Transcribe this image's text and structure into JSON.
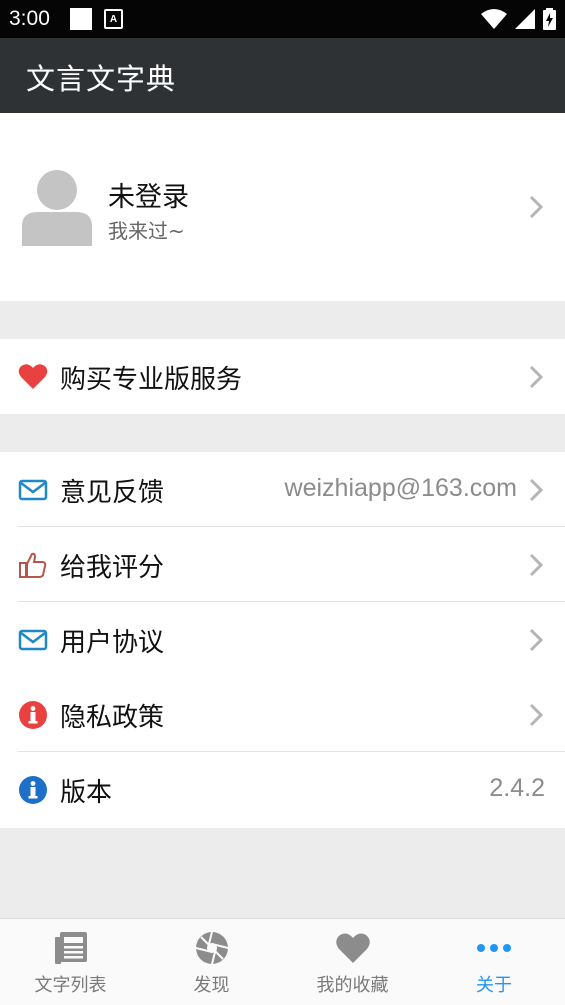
{
  "status_bar": {
    "time": "3:00",
    "a_badge": "A"
  },
  "app_bar": {
    "title": "文言文字典"
  },
  "profile": {
    "name": "未登录",
    "subtitle": "我来过~"
  },
  "menu": {
    "buy_pro": {
      "label": "购买专业版服务",
      "icon": "heart-icon",
      "color": "#e94040"
    },
    "feedback": {
      "label": "意见反馈",
      "value": "weizhiapp@163.com",
      "icon": "mail-icon",
      "color": "#1e88c8"
    },
    "rate": {
      "label": "给我评分",
      "icon": "thumbs-up-icon",
      "color": "#b05a4a"
    },
    "agreement": {
      "label": "用户协议",
      "icon": "mail-icon",
      "color": "#1e88c8"
    },
    "privacy": {
      "label": "隐私政策",
      "icon": "info-icon",
      "color": "#e94040"
    },
    "version": {
      "label": "版本",
      "value": "2.4.2",
      "icon": "info-icon",
      "color": "#1e6fc8"
    }
  },
  "bottom_nav": {
    "items": [
      {
        "label": "文字列表",
        "icon": "document-list-icon"
      },
      {
        "label": "发现",
        "icon": "aperture-icon"
      },
      {
        "label": "我的收藏",
        "icon": "heart-icon"
      },
      {
        "label": "关于",
        "icon": "more-dots-icon"
      }
    ],
    "active_index": 3,
    "active_color": "#2196f3"
  }
}
